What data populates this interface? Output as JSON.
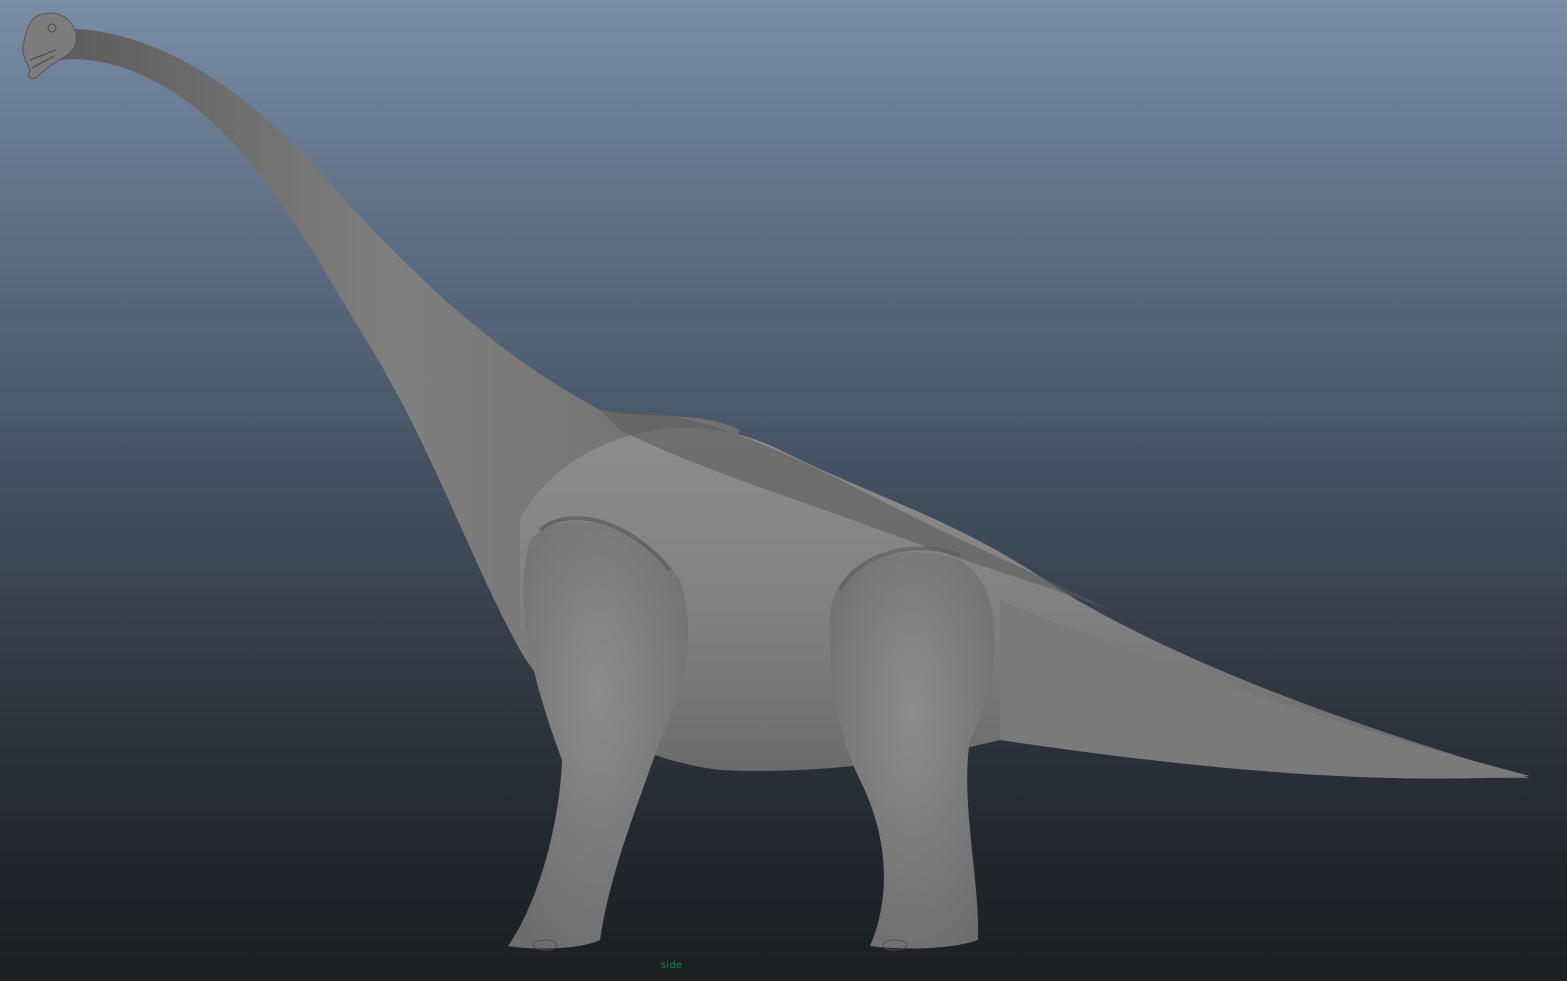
{
  "viewport": {
    "camera_name": "side",
    "background_top": "#7a8da6",
    "background_bottom": "#1c1e21",
    "label_color": "#0e8a3e"
  },
  "model": {
    "subject": "brachiosaurus-mesh",
    "shading": "smooth-gray",
    "base_color": "#858585"
  }
}
